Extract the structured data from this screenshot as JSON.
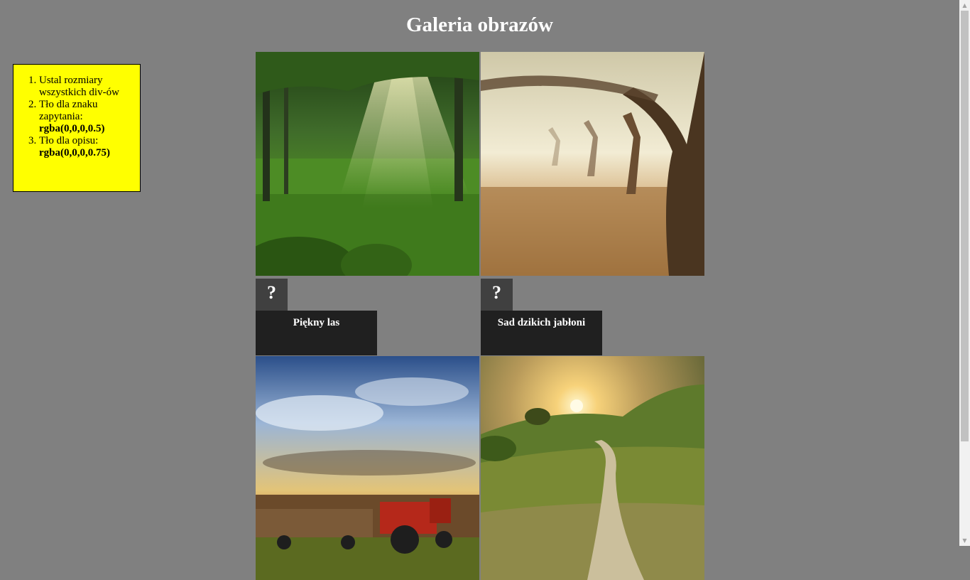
{
  "page": {
    "title": "Galeria obrazów"
  },
  "task_box": {
    "items": [
      {
        "text": "Ustal rozmiary wszystkich div-ów",
        "code": ""
      },
      {
        "text": "Tło dla znaku zapytania:",
        "code": "rgba(0,0,0,0.5)"
      },
      {
        "text": "Tło dla opisu:",
        "code": "rgba(0,0,0,0.75)"
      }
    ]
  },
  "gallery": {
    "items": [
      {
        "qmark": "?",
        "caption": "Piękny las",
        "image": "forest-sunbeams-image"
      },
      {
        "qmark": "?",
        "caption": "Sad dzikich jabłoni",
        "image": "misty-orchard-image"
      },
      {
        "qmark": "?",
        "caption": "",
        "image": "tractor-field-image"
      },
      {
        "qmark": "?",
        "caption": "",
        "image": "sunset-road-image"
      }
    ]
  },
  "colors": {
    "page_bg": "#808080",
    "task_box_bg": "#ffff00",
    "qmark_bg": "rgba(0,0,0,0.5)",
    "desc_bg": "rgba(0,0,0,0.75)"
  }
}
